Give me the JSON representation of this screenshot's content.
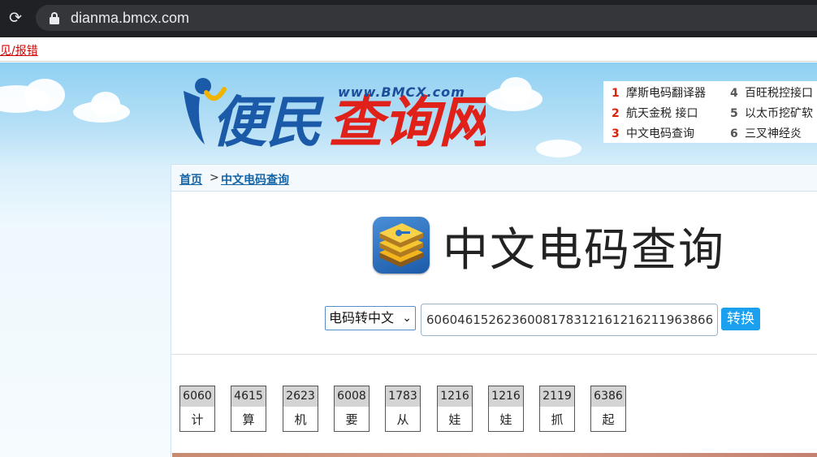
{
  "browser": {
    "url": "dianma.bmcx.com"
  },
  "feedback": {
    "link_label": "见/报错"
  },
  "header": {
    "logo_text": "便民查询网",
    "logo_domain": "www.BMCX.com",
    "hot_list": [
      {
        "num": "1",
        "label": "摩斯电码翻译器"
      },
      {
        "num": "2",
        "label": "航天金税 接口"
      },
      {
        "num": "3",
        "label": "中文电码查询"
      },
      {
        "num": "4",
        "label": "百旺税控接口"
      },
      {
        "num": "5",
        "label": "以太币挖矿软"
      },
      {
        "num": "6",
        "label": "三叉神经炎"
      }
    ]
  },
  "breadcrumb": {
    "home": "首页",
    "separator": ">",
    "current": "中文电码查询"
  },
  "main": {
    "title": "中文电码查询",
    "mode_select": "电码转中文",
    "code_input": "6060461526236008178312161216211963866",
    "convert_label": "转换"
  },
  "results": [
    {
      "code": "6060",
      "char": "计"
    },
    {
      "code": "4615",
      "char": "算"
    },
    {
      "code": "2623",
      "char": "机"
    },
    {
      "code": "6008",
      "char": "要"
    },
    {
      "code": "1783",
      "char": "从"
    },
    {
      "code": "1216",
      "char": "娃"
    },
    {
      "code": "1216",
      "char": "娃"
    },
    {
      "code": "2119",
      "char": "抓"
    },
    {
      "code": "6386",
      "char": "起"
    }
  ],
  "colors": {
    "chrome_bg": "#202124",
    "link_red": "#d40000",
    "link_blue": "#1565a7",
    "button_blue": "#1aa0ee",
    "hot_num_red": "#d9230b"
  }
}
